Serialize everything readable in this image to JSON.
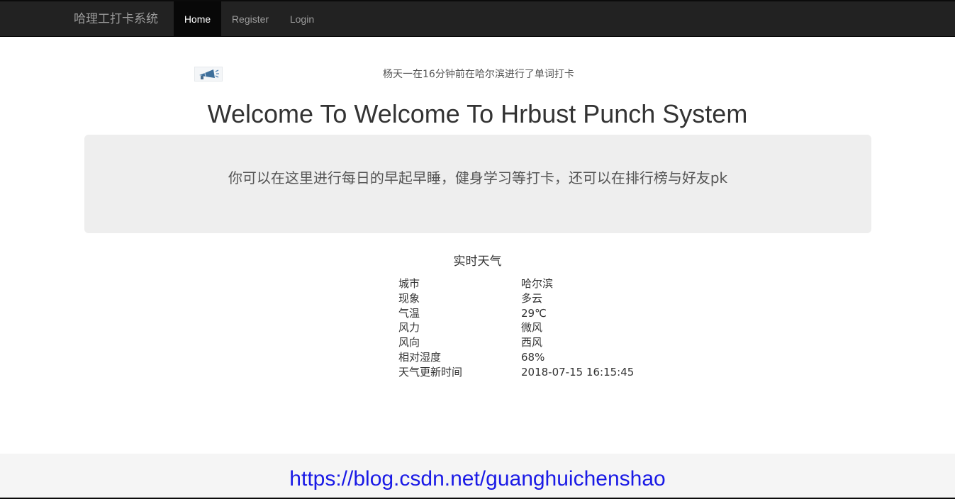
{
  "navbar": {
    "brand": "哈理工打卡系统",
    "items": [
      {
        "label": "Home",
        "active": true
      },
      {
        "label": "Register",
        "active": false
      },
      {
        "label": "Login",
        "active": false
      }
    ]
  },
  "announcement": {
    "icon": "megaphone-icon",
    "text": "杨天一在16分钟前在哈尔滨进行了单词打卡"
  },
  "page_title": "Welcome To Welcome To Hrbust Punch System",
  "jumbotron": {
    "text": "你可以在这里进行每日的早起早睡，健身学习等打卡，还可以在排行榜与好友pk"
  },
  "weather": {
    "title": "实时天气",
    "rows": [
      {
        "key": "城市",
        "value": "哈尔滨"
      },
      {
        "key": "现象",
        "value": "多云"
      },
      {
        "key": "气温",
        "value": "29℃"
      },
      {
        "key": "风力",
        "value": "微风"
      },
      {
        "key": "风向",
        "value": "西风"
      },
      {
        "key": "相对湿度",
        "value": "68%"
      },
      {
        "key": "天气更新时间",
        "value": "2018-07-15 16:15:45"
      }
    ]
  },
  "footer": {
    "watermark": "https://blog.csdn.net/guanghuichenshao"
  },
  "colors": {
    "navbar_bg": "#222222",
    "navbar_active_bg": "#080808",
    "jumbotron_bg": "#eeeeee",
    "footer_bg": "#f5f5f5",
    "link_blue": "#1a1ae6"
  }
}
